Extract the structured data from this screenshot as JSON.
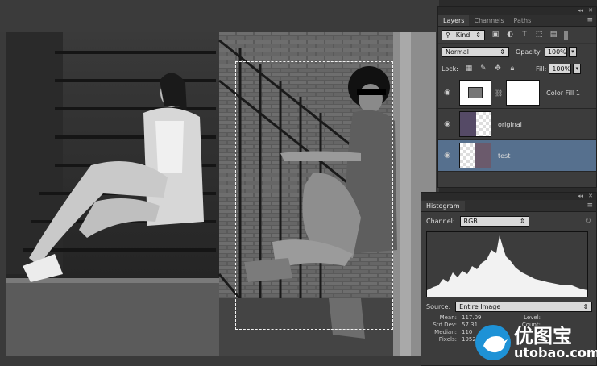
{
  "layers_panel": {
    "tabs": [
      "Layers",
      "Channels",
      "Paths"
    ],
    "filter_kind": "Kind",
    "blend_mode": "Normal",
    "opacity_label": "Opacity:",
    "opacity_value": "100%",
    "lock_label": "Lock:",
    "fill_label": "Fill:",
    "fill_value": "100%",
    "layers": [
      {
        "name": "Color Fill 1"
      },
      {
        "name": "original"
      },
      {
        "name": "test"
      }
    ]
  },
  "histogram": {
    "title": "Histogram",
    "channel_label": "Channel:",
    "channel_value": "RGB",
    "source_label": "Source:",
    "source_value": "Entire Image",
    "mean_label": "Mean:",
    "mean_value": "117.09",
    "stddev_label": "Std Dev:",
    "stddev_value": "57.31",
    "median_label": "Median:",
    "median_value": "110",
    "pixels_label": "Pixels:",
    "pixels_value": "19527",
    "level_label": "Level:",
    "count_label": "Count:"
  },
  "watermark": {
    "line1": "优图宝",
    "line2": "utobao.com"
  },
  "colors": {
    "selected_layer": "#56708e",
    "watermark_blue": "#1e92d6"
  }
}
